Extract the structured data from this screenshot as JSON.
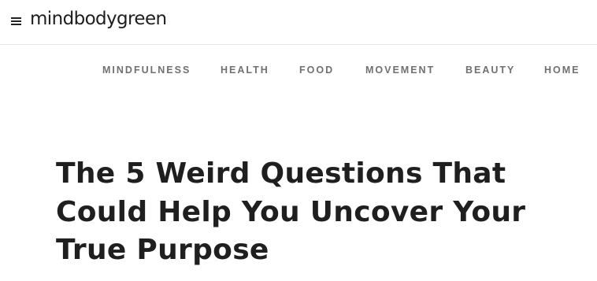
{
  "header": {
    "menu_icon": "hamburger-menu-icon",
    "logo_text": "mindbodygreen"
  },
  "nav": {
    "items": [
      {
        "label": "MINDFULNESS"
      },
      {
        "label": "HEALTH"
      },
      {
        "label": "FOOD"
      },
      {
        "label": "MOVEMENT"
      },
      {
        "label": "BEAUTY"
      },
      {
        "label": "HOME"
      }
    ]
  },
  "article": {
    "title": "The 5 Weird Questions That Could Help You Uncover Your True Purpose"
  }
}
